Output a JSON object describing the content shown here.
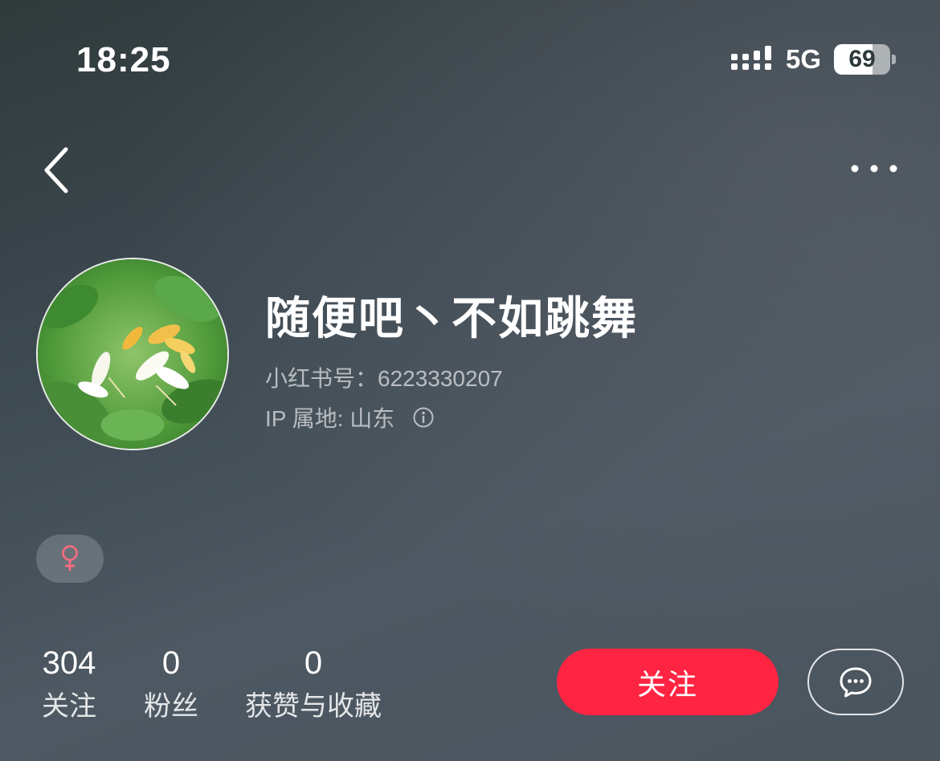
{
  "status_bar": {
    "time": "18:25",
    "network": "5G",
    "battery_level": "69",
    "battery_fraction": 0.69
  },
  "nav": {
    "back_icon": "chevron-left-icon",
    "more_icon": "more-horizontal-icon"
  },
  "profile": {
    "nickname": "随便吧丶不如跳舞",
    "id_line": "小红书号：6223330207",
    "ip_line": "IP 属地: 山东",
    "gender_icon": "female-icon",
    "gender_color": "#ff6b81"
  },
  "stats": [
    {
      "value": "304",
      "label": "关注"
    },
    {
      "value": "0",
      "label": "粉丝"
    },
    {
      "value": "0",
      "label": "获赞与收藏"
    }
  ],
  "actions": {
    "follow_label": "关注",
    "follow_color": "#ff2442",
    "chat_icon": "chat-bubble-icon"
  }
}
